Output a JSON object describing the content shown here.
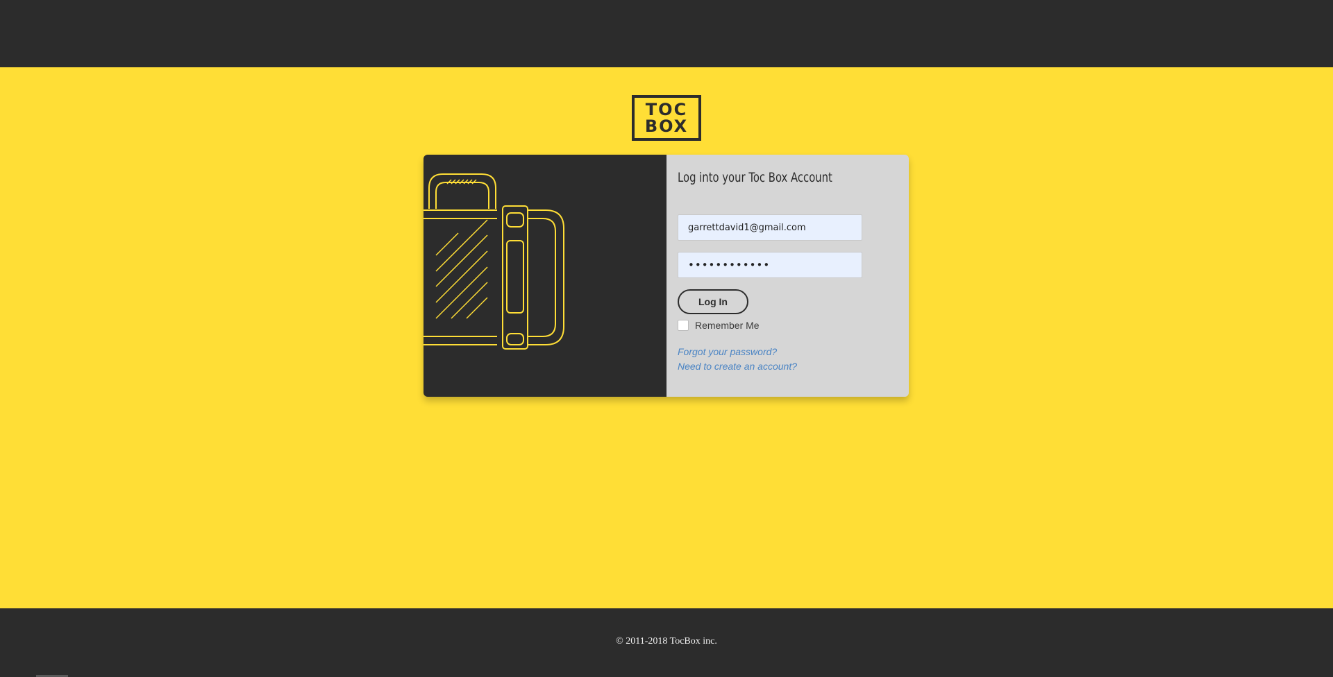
{
  "colors": {
    "brand_yellow": "#ffde36",
    "dark": "#2c2c2c",
    "form_bg": "#d6d6d6",
    "link": "#4a84c4",
    "input_bg": "#e8f0fe"
  },
  "logo": {
    "line1": "TOC",
    "line2": "BOX",
    "icon": "tocbox-logo"
  },
  "illustration": {
    "icon": "lunchbox-illustration-icon"
  },
  "login": {
    "title": "Log into your Toc Box Account",
    "email_value": "garrettdavid1@gmail.com",
    "password_value": "••••••••••••",
    "submit_label": "Log In",
    "remember_label": "Remember Me",
    "remember_checked": false,
    "forgot_link": "Forgot your password?",
    "create_link": "Need to create an account?"
  },
  "footer": {
    "copyright": "© 2011-2018 TocBox inc."
  }
}
